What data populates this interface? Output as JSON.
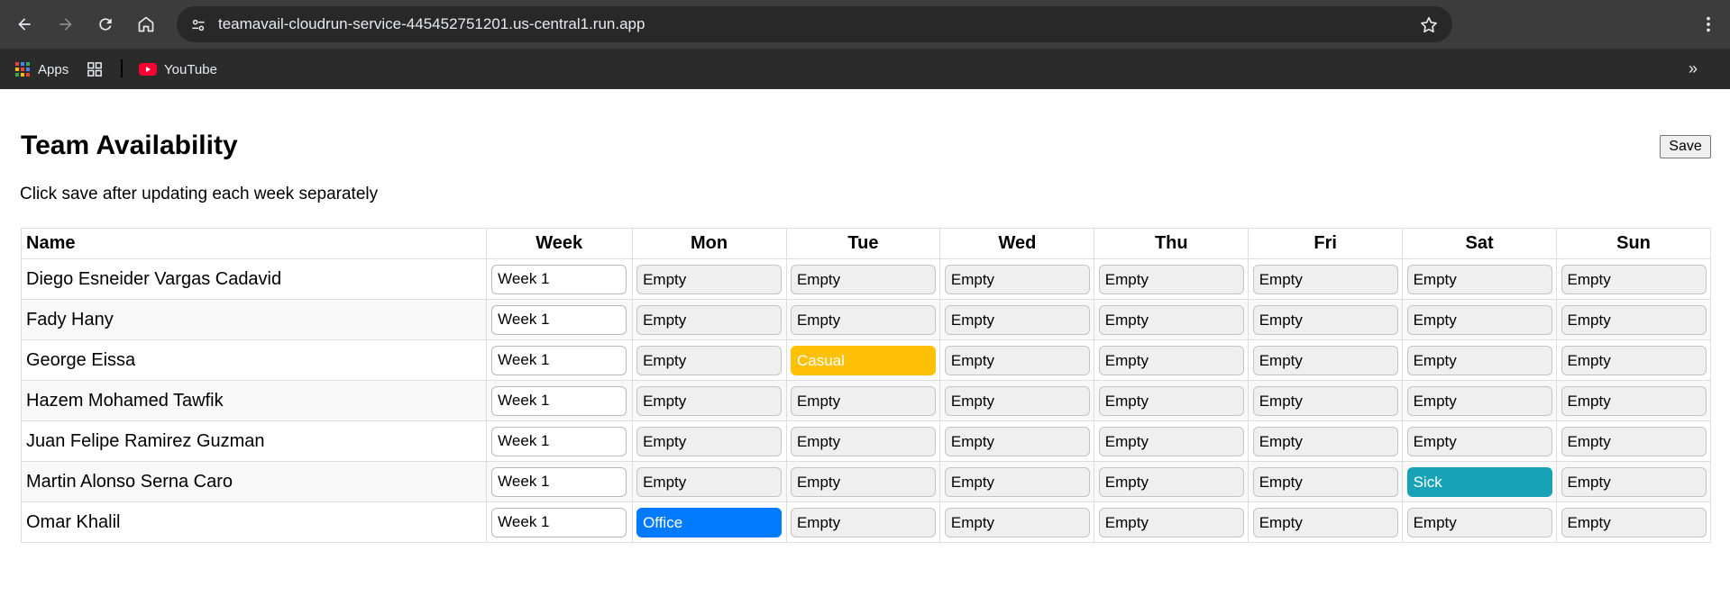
{
  "browser": {
    "url": "teamavail-cloudrun-service-445452751201.us-central1.run.app",
    "bookmarks": [
      {
        "label": "Apps"
      },
      {
        "label": ""
      },
      {
        "label": "YouTube"
      }
    ]
  },
  "page": {
    "title": "Team Availability",
    "save_label": "Save",
    "subtitle": "Click save after updating each week separately"
  },
  "table": {
    "headers": [
      "Name",
      "Week",
      "Mon",
      "Tue",
      "Wed",
      "Thu",
      "Fri",
      "Sat",
      "Sun"
    ],
    "rows": [
      {
        "name": "Diego Esneider Vargas Cadavid",
        "week": "Week 1",
        "days": [
          "Empty",
          "Empty",
          "Empty",
          "Empty",
          "Empty",
          "Empty",
          "Empty"
        ]
      },
      {
        "name": "Fady Hany",
        "week": "Week 1",
        "days": [
          "Empty",
          "Empty",
          "Empty",
          "Empty",
          "Empty",
          "Empty",
          "Empty"
        ]
      },
      {
        "name": "George Eissa",
        "week": "Week 1",
        "days": [
          "Empty",
          "Casual",
          "Empty",
          "Empty",
          "Empty",
          "Empty",
          "Empty"
        ]
      },
      {
        "name": "Hazem Mohamed Tawfik",
        "week": "Week 1",
        "days": [
          "Empty",
          "Empty",
          "Empty",
          "Empty",
          "Empty",
          "Empty",
          "Empty"
        ]
      },
      {
        "name": "Juan Felipe Ramirez Guzman",
        "week": "Week 1",
        "days": [
          "Empty",
          "Empty",
          "Empty",
          "Empty",
          "Empty",
          "Empty",
          "Empty"
        ]
      },
      {
        "name": "Martin Alonso Serna Caro",
        "week": "Week 1",
        "days": [
          "Empty",
          "Empty",
          "Empty",
          "Empty",
          "Empty",
          "Sick",
          "Empty"
        ]
      },
      {
        "name": "Omar Khalil",
        "week": "Week 1",
        "days": [
          "Office",
          "Empty",
          "Empty",
          "Empty",
          "Empty",
          "Empty",
          "Empty"
        ]
      }
    ]
  },
  "status_colors": {
    "Casual": "#ffc107",
    "Sick": "#17a2b8",
    "Office": "#007bff",
    "Empty": "#efefef"
  }
}
